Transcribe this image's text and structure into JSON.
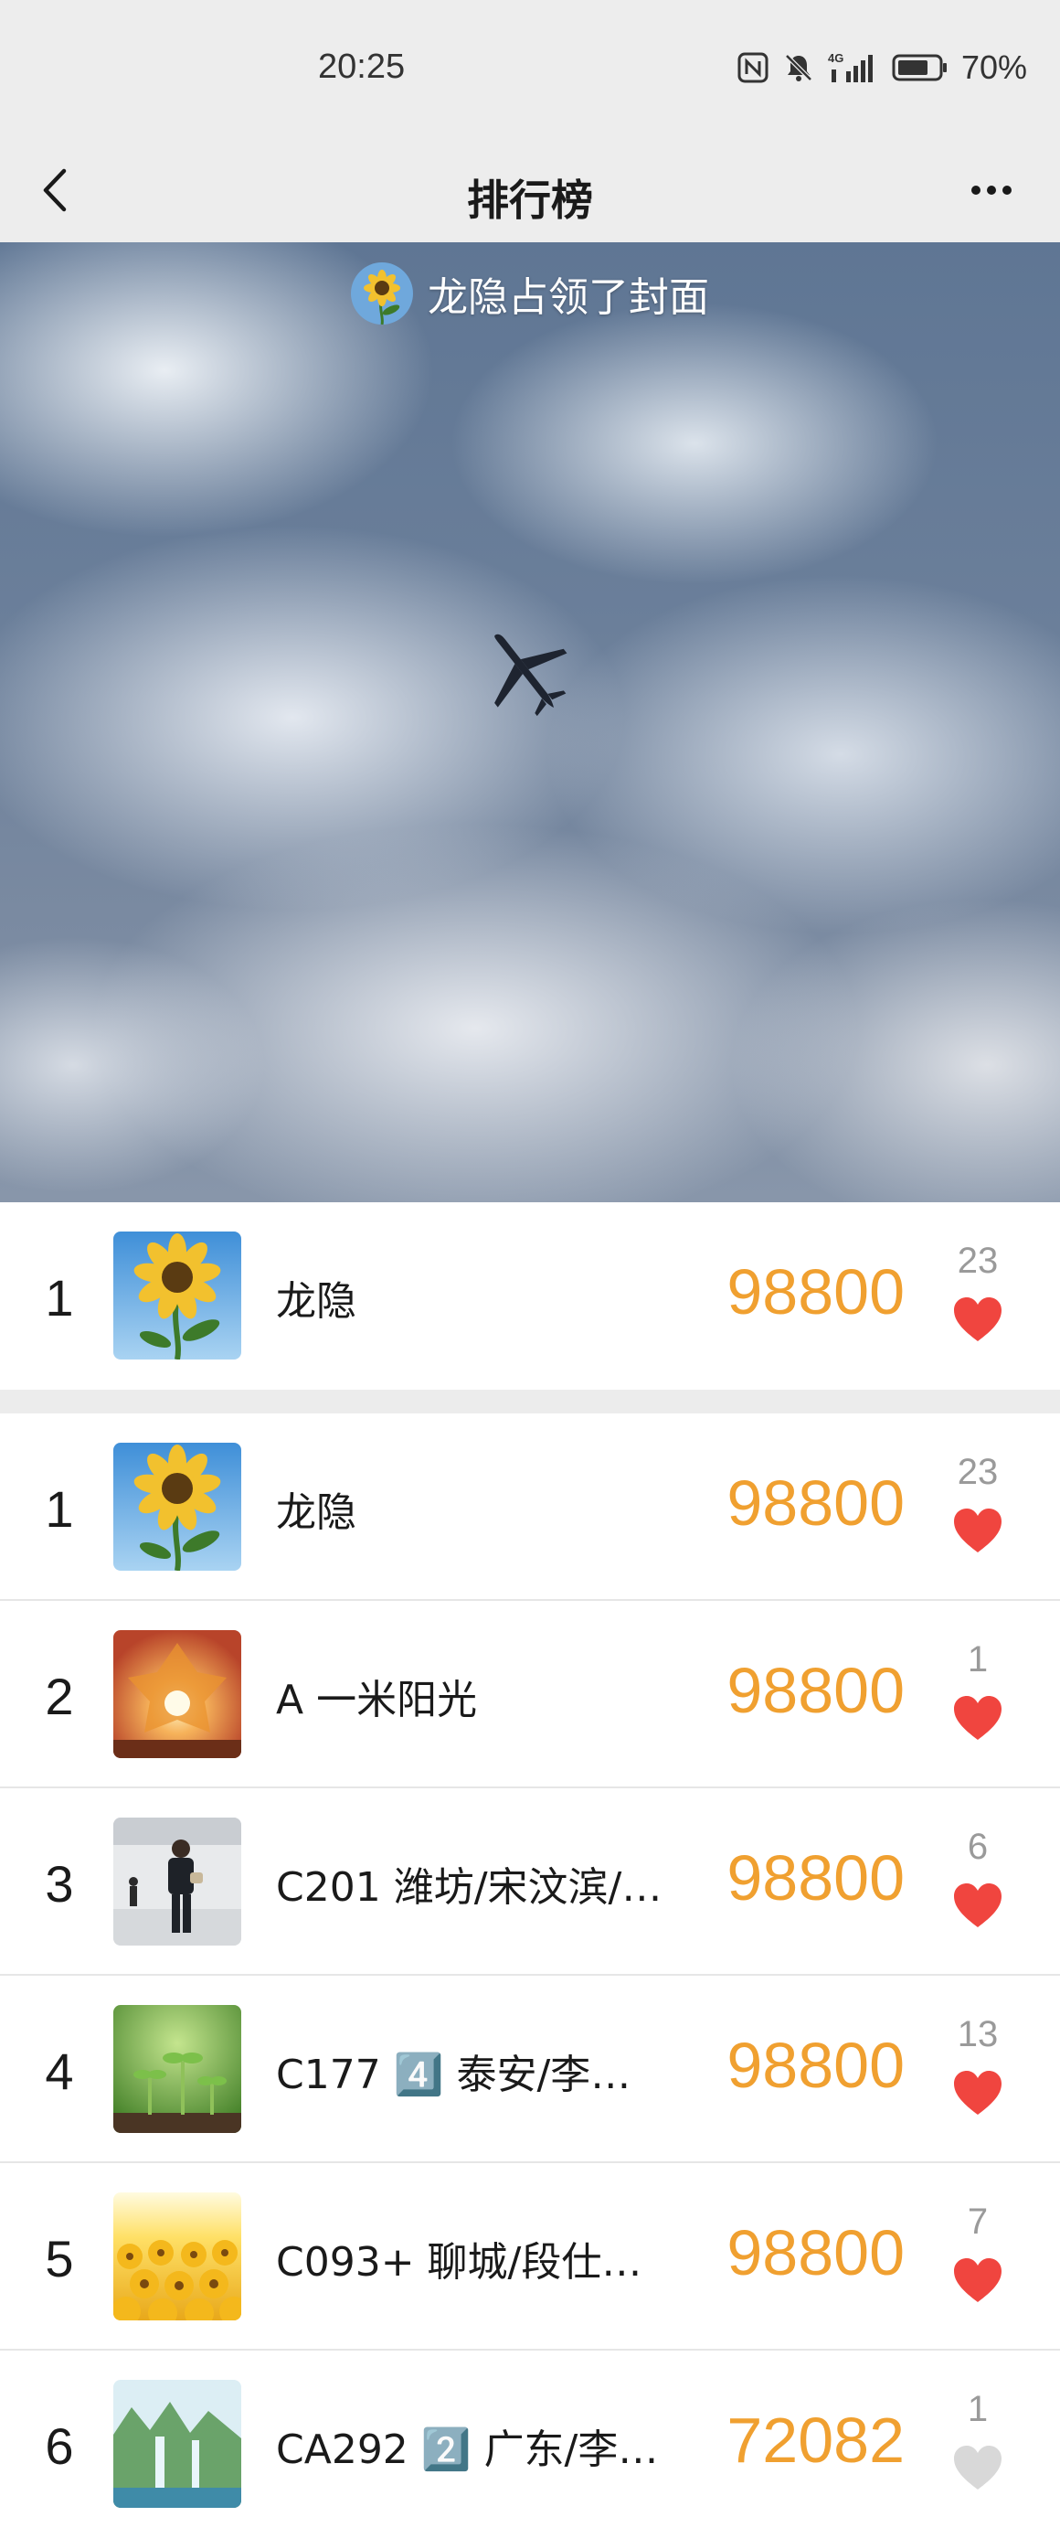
{
  "status_bar": {
    "time": "20:25",
    "battery": "70%"
  },
  "nav": {
    "title": "排行榜"
  },
  "cover": {
    "caption": "龙隐占领了封面"
  },
  "featured": {
    "rank": "1",
    "name": "龙隐",
    "score": "98800",
    "likes": "23",
    "thumb": "sunflower"
  },
  "rows": [
    {
      "rank": "1",
      "name": "龙隐",
      "score": "98800",
      "likes": "23",
      "thumb": "sunflower",
      "liked": true
    },
    {
      "rank": "2",
      "name": "A 一米阳光",
      "score": "98800",
      "likes": "1",
      "thumb": "sunset-leaf",
      "liked": true
    },
    {
      "rank": "3",
      "name": "C201 潍坊/宋汶滨/…",
      "score": "98800",
      "likes": "6",
      "thumb": "person",
      "liked": true
    },
    {
      "rank": "4",
      "name": "C177 4️⃣  泰安/李…",
      "score": "98800",
      "likes": "13",
      "thumb": "sprouts",
      "liked": true
    },
    {
      "rank": "5",
      "name": "C093+  聊城/段仕…",
      "score": "98800",
      "likes": "7",
      "thumb": "sunflower-field",
      "liked": true
    },
    {
      "rank": "6",
      "name": "CA292 2️⃣ 广东/李…",
      "score": "72082",
      "likes": "1",
      "thumb": "waterfall",
      "liked": false
    }
  ],
  "colors": {
    "score": "#f0a030",
    "heart": "#f0453f",
    "heart_inactive": "#d8d8d8"
  }
}
